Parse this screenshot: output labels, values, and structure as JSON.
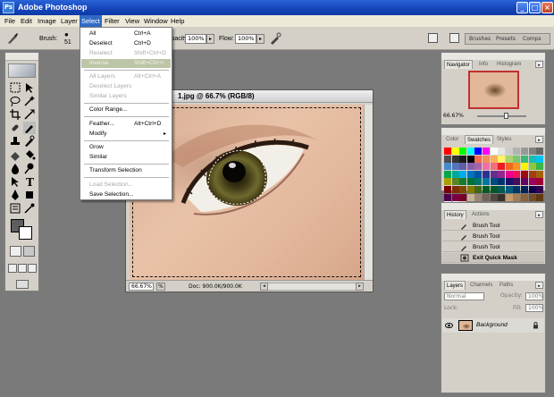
{
  "window": {
    "title": "Adobe Photoshop",
    "icon_text": "Ps"
  },
  "menubar": {
    "items": [
      "File",
      "Edit",
      "Image",
      "Layer",
      "Select",
      "Filter",
      "View",
      "Window",
      "Help"
    ],
    "active": "Select"
  },
  "options": {
    "brush_label": "Brush:",
    "brush_size": "51",
    "opacity_label": "Opacity:",
    "opacity_value": "100%",
    "flow_label": "Flow:",
    "flow_value": "100%",
    "well_tabs": [
      "Brushes",
      "Presets",
      "Comps"
    ]
  },
  "select_menu": {
    "items": [
      {
        "label": "All",
        "shortcut": "Ctrl+A",
        "enabled": true
      },
      {
        "label": "Deselect",
        "shortcut": "Ctrl+D",
        "enabled": true
      },
      {
        "label": "Reselect",
        "shortcut": "Shift+Ctrl+D",
        "enabled": false
      },
      {
        "label": "Inverse",
        "shortcut": "Shift+Ctrl+I",
        "enabled": true,
        "highlighted": true
      },
      {
        "label": "All Layers",
        "shortcut": "Alt+Ctrl+A",
        "enabled": false
      },
      {
        "label": "Deselect Layers",
        "shortcut": "",
        "enabled": false
      },
      {
        "label": "Similar Layers",
        "shortcut": "",
        "enabled": false
      },
      {
        "label": "Color Range...",
        "shortcut": "",
        "enabled": true
      },
      {
        "label": "Feather...",
        "shortcut": "Alt+Ctrl+D",
        "enabled": true
      },
      {
        "label": "Modify",
        "shortcut": "",
        "enabled": true,
        "submenu": true
      },
      {
        "label": "Grow",
        "shortcut": "",
        "enabled": true
      },
      {
        "label": "Similar",
        "shortcut": "",
        "enabled": true
      },
      {
        "label": "Transform Selection",
        "shortcut": "",
        "enabled": true
      },
      {
        "label": "Load Selection...",
        "shortcut": "",
        "enabled": false
      },
      {
        "label": "Save Selection...",
        "shortcut": "",
        "enabled": true
      }
    ]
  },
  "document": {
    "title": "1.jpg @ 66.7% (RGB/8)",
    "zoom": "66.67%",
    "info": "Doc: 900.0K/900.0K"
  },
  "navigator": {
    "tabs": [
      "Navigator",
      "Info",
      "Histogram"
    ],
    "zoom": "66.67%"
  },
  "swatches": {
    "tabs": [
      "Color",
      "Swatches",
      "Styles"
    ],
    "colors": [
      "#ff0000",
      "#ffff00",
      "#00ff00",
      "#00ffff",
      "#0000ff",
      "#ff00ff",
      "#ffffff",
      "#e6e6e6",
      "#cccccc",
      "#b3b3b3",
      "#999999",
      "#808080",
      "#666666",
      "#4d4d4d",
      "#333333",
      "#1a1a1a",
      "#000000",
      "#f26c4f",
      "#f68e56",
      "#fbaf5d",
      "#fff467",
      "#acd372",
      "#7cc576",
      "#3bb878",
      "#1abbb4",
      "#00bff3",
      "#438ccb",
      "#5574b9",
      "#605ca8",
      "#855fa8",
      "#a763a8",
      "#f06ea9",
      "#f26d7d",
      "#ed1c24",
      "#f26522",
      "#f7941d",
      "#fff200",
      "#8dc73f",
      "#39b54a",
      "#00a651",
      "#00a99d",
      "#00aeef",
      "#0072bc",
      "#0054a6",
      "#2e3192",
      "#662d91",
      "#92278f",
      "#ec008c",
      "#ed145b",
      "#9e0b0f",
      "#a0410d",
      "#a36209",
      "#aba000",
      "#598527",
      "#197b30",
      "#007236",
      "#00746b",
      "#0076a3",
      "#004b80",
      "#003471",
      "#1b1464",
      "#440e62",
      "#630460",
      "#9e005d",
      "#9e0039",
      "#790000",
      "#7b2e00",
      "#7d4900",
      "#827b00",
      "#406618",
      "#005e20",
      "#005826",
      "#005952",
      "#005b7f",
      "#003663",
      "#002157",
      "#0d004c",
      "#32004b",
      "#4b0049",
      "#7b0046",
      "#7a0026",
      "#c7b299",
      "#998675",
      "#736357",
      "#534741",
      "#37302d",
      "#c69c6d",
      "#a67c52",
      "#8c6239",
      "#754c24",
      "#603913",
      "#ffffff",
      "#f5f5f5",
      "#d4d0c8"
    ]
  },
  "history": {
    "tabs": [
      "History",
      "Actions"
    ],
    "rows": [
      {
        "label": "Brush Tool",
        "active": false
      },
      {
        "label": "Brush Tool",
        "active": false
      },
      {
        "label": "Brush Tool",
        "active": false
      },
      {
        "label": "Exit Quick Mask",
        "active": true
      }
    ]
  },
  "layers": {
    "tabs": [
      "Layers",
      "Channels",
      "Paths"
    ],
    "blend_mode": "Normal",
    "opacity_label": "Opacity:",
    "opacity": "100%",
    "lock_label": "Lock:",
    "fill_label": "Fill:",
    "fill": "100%",
    "layer_name": "Background"
  }
}
